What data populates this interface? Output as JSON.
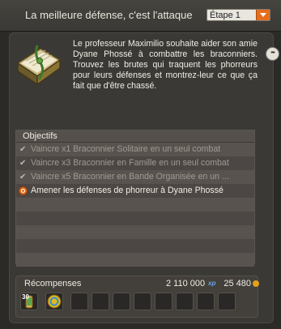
{
  "window": {
    "title": "La meilleure défense, c'est l'attaque"
  },
  "step_select": {
    "selected": "Étape 1"
  },
  "more_button": {
    "label": "•••"
  },
  "quest": {
    "description": "Le professeur Maximilio souhaite aider son amie Dyane Phossé à combattre les braconniers. Trouvez les brutes qui traquent les phorreurs pour leurs défenses et montrez-leur ce que ça fait que d'être chassé."
  },
  "objectives": {
    "header": "Objectifs",
    "items": [
      {
        "label": "Vaincre x1 Braconnier Solitaire en un seul combat",
        "status": "done"
      },
      {
        "label": "Vaincre x3 Braconnier en Famille en un seul combat",
        "status": "done"
      },
      {
        "label": "Vaincre x5 Braconnier en Bande Organisée en un ...",
        "status": "done"
      },
      {
        "label": "Amener les défenses de phorreur à Dyane Phossé",
        "status": "active"
      }
    ]
  },
  "rewards": {
    "header": "Récompenses",
    "xp": "2 110 000",
    "xp_label": "xp",
    "kamas": "25 480",
    "items": [
      {
        "icon": "scroll-item-icon",
        "quantity": "30"
      },
      {
        "icon": "gold-coin-item-icon",
        "quantity": ""
      }
    ],
    "empty_slots": 8
  },
  "colors": {
    "accent": "#e56d1c",
    "panel": "#3a3935",
    "done_text": "#9f9a92"
  }
}
